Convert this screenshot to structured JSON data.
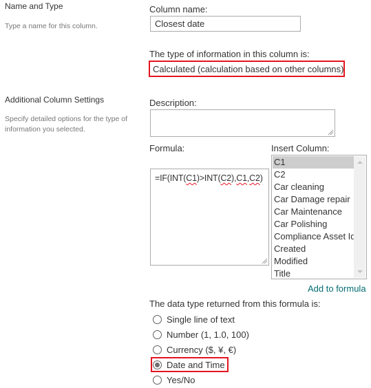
{
  "name_and_type": {
    "title": "Name and Type",
    "description": "Type a name for this column.",
    "column_name_label": "Column name:",
    "column_name_value": "Closest date",
    "type_label": "The type of information in this column is:",
    "type_value": "Calculated (calculation based on other columns)"
  },
  "additional_settings": {
    "title": "Additional Column Settings",
    "description": "Specify detailed options for the type of information you selected.",
    "description_label": "Description:",
    "description_value": "",
    "formula_label": "Formula:",
    "formula_parts": [
      "=IF(INT(",
      "C1",
      ")>INT(",
      "C2",
      "),",
      "C1",
      ",",
      "C2",
      ")"
    ],
    "insert_column_label": "Insert Column:",
    "insert_column_items": [
      {
        "label": "C1",
        "selected": true
      },
      {
        "label": "C2",
        "selected": false
      },
      {
        "label": "Car cleaning",
        "selected": false
      },
      {
        "label": "Car Damage repair",
        "selected": false
      },
      {
        "label": "Car Maintenance",
        "selected": false
      },
      {
        "label": "Car Polishing",
        "selected": false
      },
      {
        "label": "Compliance Asset Id",
        "selected": false
      },
      {
        "label": "Created",
        "selected": false
      },
      {
        "label": "Modified",
        "selected": false
      },
      {
        "label": "Title",
        "selected": false
      }
    ],
    "add_to_formula_label": "Add to formula",
    "return_type_label": "The data type returned from this formula is:",
    "return_type_options": [
      {
        "label": "Single line of text",
        "checked": false
      },
      {
        "label": "Number (1, 1.0, 100)",
        "checked": false
      },
      {
        "label": "Currency ($, ¥, €)",
        "checked": false
      },
      {
        "label": "Date and Time",
        "checked": true
      },
      {
        "label": "Yes/No",
        "checked": false
      }
    ]
  },
  "colors": {
    "highlight_border": "#e3141e",
    "link": "#036c70",
    "selected_item_bg": "#cdcdcd"
  }
}
